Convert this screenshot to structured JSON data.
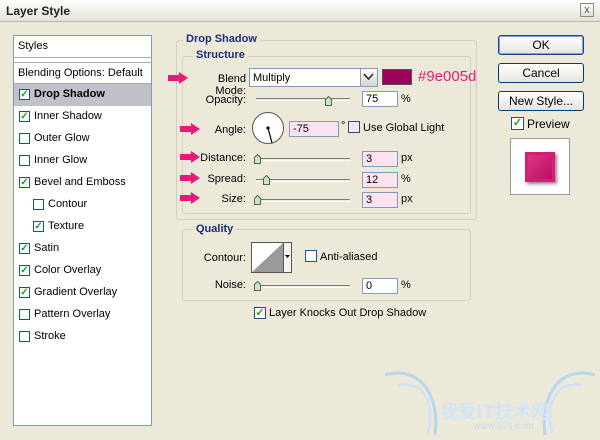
{
  "window": {
    "title": "Layer Style",
    "close_label": "x"
  },
  "left_panel": {
    "header": "Styles",
    "blending_options": "Blending Options: Default",
    "items": [
      {
        "label": "Drop Shadow",
        "checked": true,
        "selected": true,
        "indent": false
      },
      {
        "label": "Inner Shadow",
        "checked": true,
        "selected": false,
        "indent": false
      },
      {
        "label": "Outer Glow",
        "checked": false,
        "selected": false,
        "indent": false
      },
      {
        "label": "Inner Glow",
        "checked": false,
        "selected": false,
        "indent": false
      },
      {
        "label": "Bevel and Emboss",
        "checked": true,
        "selected": false,
        "indent": false
      },
      {
        "label": "Contour",
        "checked": false,
        "selected": false,
        "indent": true
      },
      {
        "label": "Texture",
        "checked": true,
        "selected": false,
        "indent": true
      },
      {
        "label": "Satin",
        "checked": true,
        "selected": false,
        "indent": false
      },
      {
        "label": "Color Overlay",
        "checked": true,
        "selected": false,
        "indent": false
      },
      {
        "label": "Gradient Overlay",
        "checked": true,
        "selected": false,
        "indent": false
      },
      {
        "label": "Pattern Overlay",
        "checked": false,
        "selected": false,
        "indent": false
      },
      {
        "label": "Stroke",
        "checked": false,
        "selected": false,
        "indent": false
      }
    ]
  },
  "drop_shadow": {
    "section_title": "Drop Shadow",
    "structure_title": "Structure",
    "blend_mode_label": "Blend Mode:",
    "blend_mode_value": "Multiply",
    "shadow_color": "#9e005d",
    "color_annotation": "#9e005d",
    "opacity_label": "Opacity:",
    "opacity_value": "75",
    "opacity_unit": "%",
    "angle_label": "Angle:",
    "angle_value": "-75",
    "angle_unit": "°",
    "use_global_light_label": "Use Global Light",
    "use_global_light_checked": false,
    "distance_label": "Distance:",
    "distance_value": "3",
    "distance_unit": "px",
    "spread_label": "Spread:",
    "spread_value": "12",
    "spread_unit": "%",
    "size_label": "Size:",
    "size_value": "3",
    "size_unit": "px",
    "quality_title": "Quality",
    "contour_label": "Contour:",
    "anti_aliased_label": "Anti-aliased",
    "anti_aliased_checked": false,
    "noise_label": "Noise:",
    "noise_value": "0",
    "noise_unit": "%",
    "knocks_out_label": "Layer Knocks Out Drop Shadow",
    "knocks_out_checked": true
  },
  "buttons": {
    "ok": "OK",
    "cancel": "Cancel",
    "new_style": "New Style...",
    "preview_label": "Preview",
    "preview_checked": true
  },
  "watermark": {
    "chinese_text": "我爱IT技术网",
    "url": "www.52ij.com"
  },
  "colors": {
    "arrow": "#e8197a",
    "accent_pink": "#fde3ef",
    "title_blue": "#1a2f7a"
  }
}
